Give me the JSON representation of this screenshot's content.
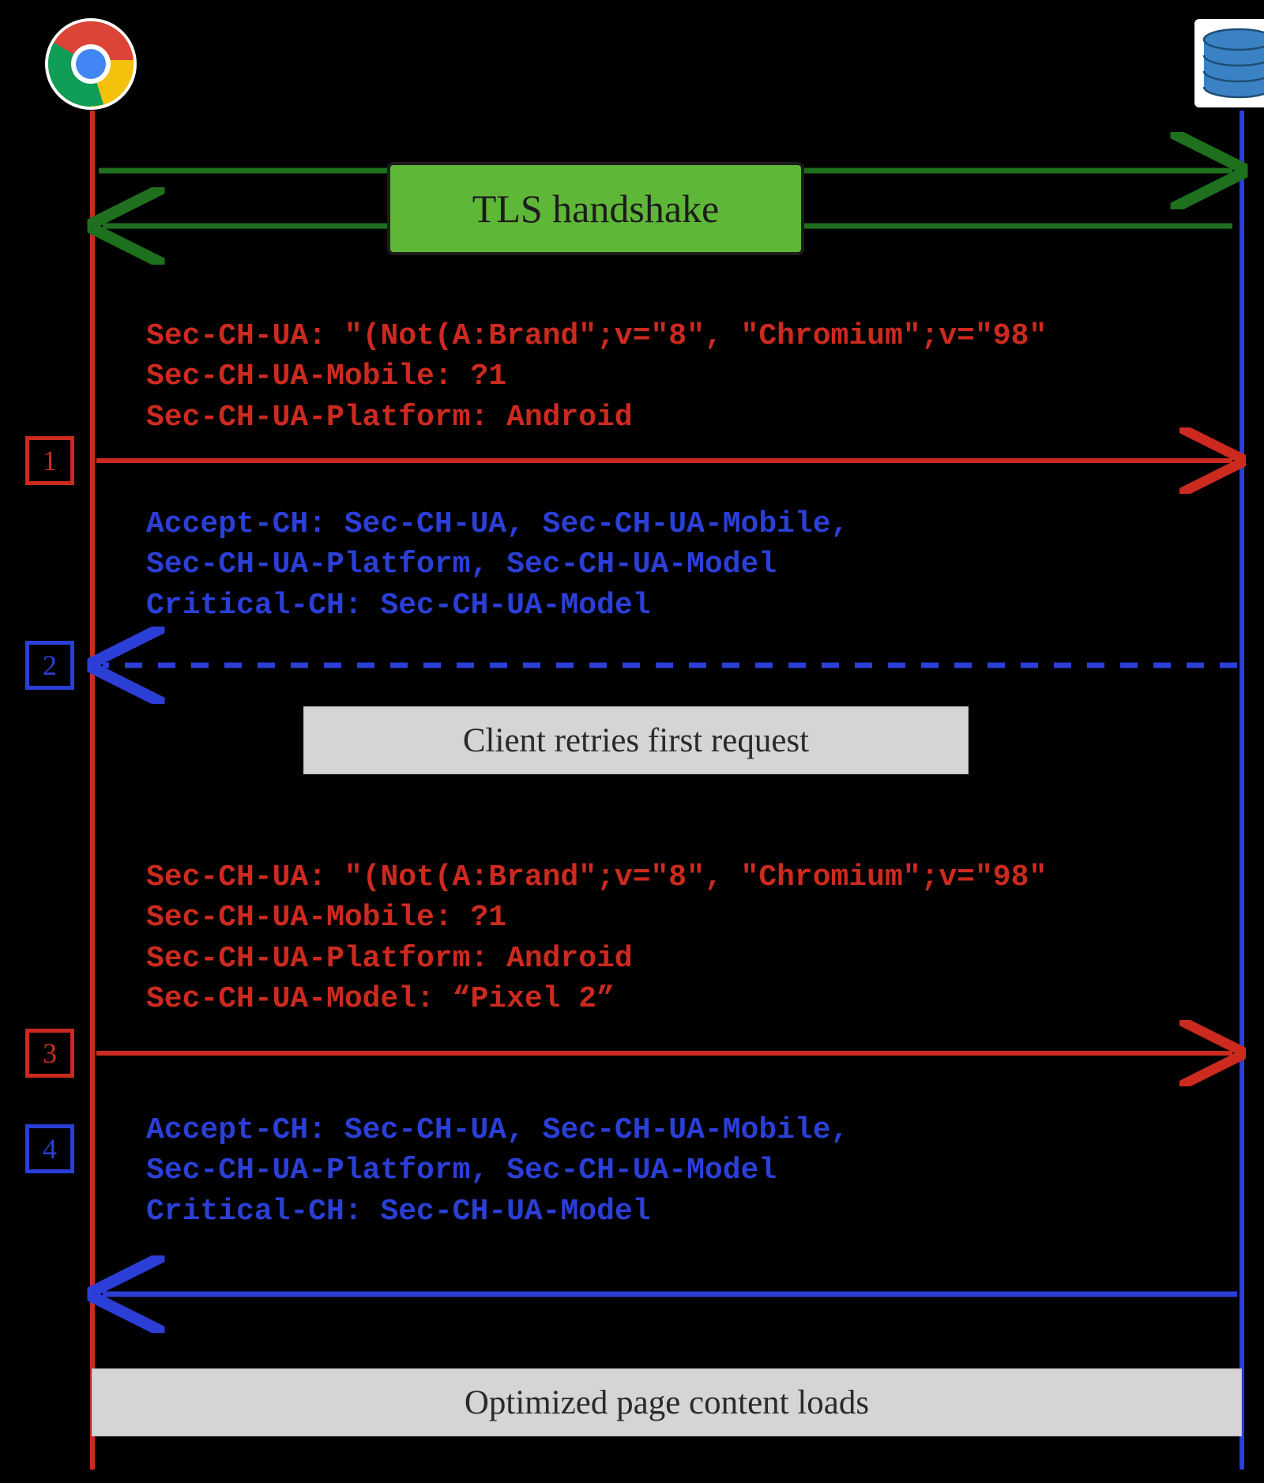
{
  "actors": {
    "client": "Chrome browser",
    "server": "Server"
  },
  "tls": {
    "label": "TLS handshake"
  },
  "steps": {
    "s1": "1",
    "s2": "2",
    "s3": "3",
    "s4": "4"
  },
  "headers1": "Sec-CH-UA: \"(Not(A:Brand\";v=\"8\", \"Chromium\";v=\"98\"\nSec-CH-UA-Mobile: ?1\nSec-CH-UA-Platform: Android",
  "headers2": "Accept-CH: Sec-CH-UA, Sec-CH-UA-Mobile,\nSec-CH-UA-Platform, Sec-CH-UA-Model\nCritical-CH: Sec-CH-UA-Model",
  "banner1": "Client retries first request",
  "headers3": "Sec-CH-UA: \"(Not(A:Brand\";v=\"8\", \"Chromium\";v=\"98\"\nSec-CH-UA-Mobile: ?1\nSec-CH-UA-Platform: Android\nSec-CH-UA-Model: “Pixel 2”",
  "headers4": "Accept-CH: Sec-CH-UA, Sec-CH-UA-Mobile,\nSec-CH-UA-Platform, Sec-CH-UA-Model\nCritical-CH: Sec-CH-UA-Model",
  "banner2": "Optimized page content loads"
}
